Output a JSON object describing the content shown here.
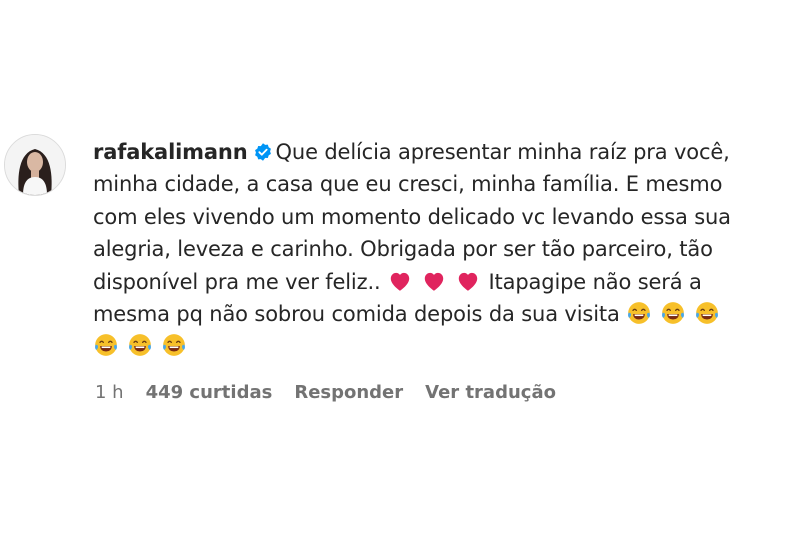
{
  "comment": {
    "username": "rafakalimann",
    "verified_icon": "verified-badge-icon",
    "lines": [
      "Que delícia apresentar minha raíz pra você,",
      "minha cidade, a casa que eu cresci, minha família. E mesmo",
      "com eles vivendo um momento delicado vc levando essa sua",
      "alegria, leveza e carinho. Obrigada por ser tão parceiro, tão",
      "disponível pra me ver feliz..",
      "Itapagipe não será a",
      "mesma pq não sobrou comida depois da sua visita"
    ],
    "emoji_heart": "red-heart-icon",
    "emoji_laugh": "face-with-tears-of-joy-icon"
  },
  "meta": {
    "time": "1 h",
    "likes": "449 curtidas",
    "reply": "Responder",
    "translate": "Ver tradução"
  },
  "colors": {
    "text": "#262626",
    "secondary": "#737373",
    "verified": "#0095f6",
    "heart": "#e0245e"
  }
}
